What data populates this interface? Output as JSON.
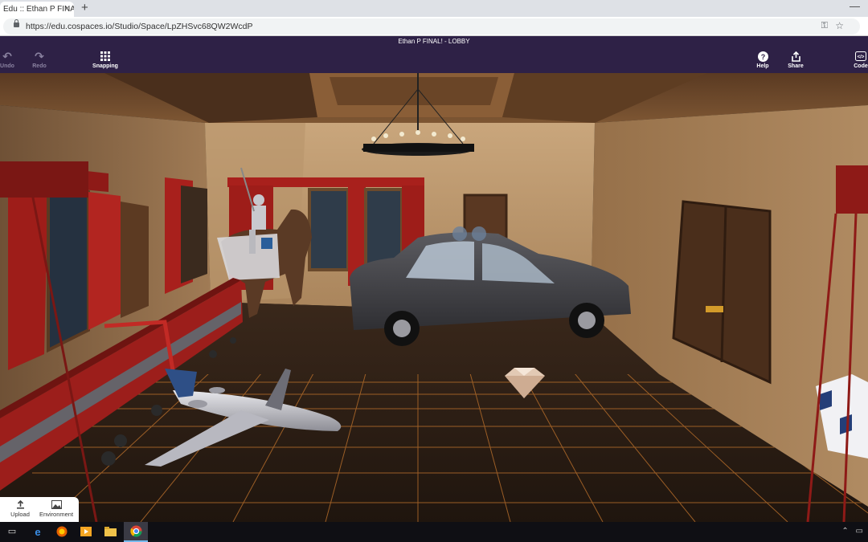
{
  "browser": {
    "tab_title": "Edu :: Ethan P FINAL!",
    "tab_close": "×",
    "new_tab": "+",
    "minimize": "—",
    "url": "https://edu.cospaces.io/Studio/Space/LpZHSvc68QW2WcdP"
  },
  "appbar": {
    "title": "Ethan P FINAL! - LOBBY",
    "undo": "Undo",
    "redo": "Redo",
    "snapping": "Snapping",
    "help": "Help",
    "share": "Share",
    "code": "Code"
  },
  "bottom_tools": {
    "upload": "Upload",
    "environment": "Environment"
  },
  "icons": {
    "undo": "undo-icon",
    "redo": "redo-icon",
    "snapping": "grid-icon",
    "help": "help-icon",
    "share": "share-icon",
    "code": "code-icon",
    "upload": "upload-icon",
    "environment": "image-icon"
  },
  "colors": {
    "appbar": "#2e2146",
    "floor": "#2a1e15",
    "grid_lines": "#b06a2a",
    "curtains": "#a8201c"
  }
}
